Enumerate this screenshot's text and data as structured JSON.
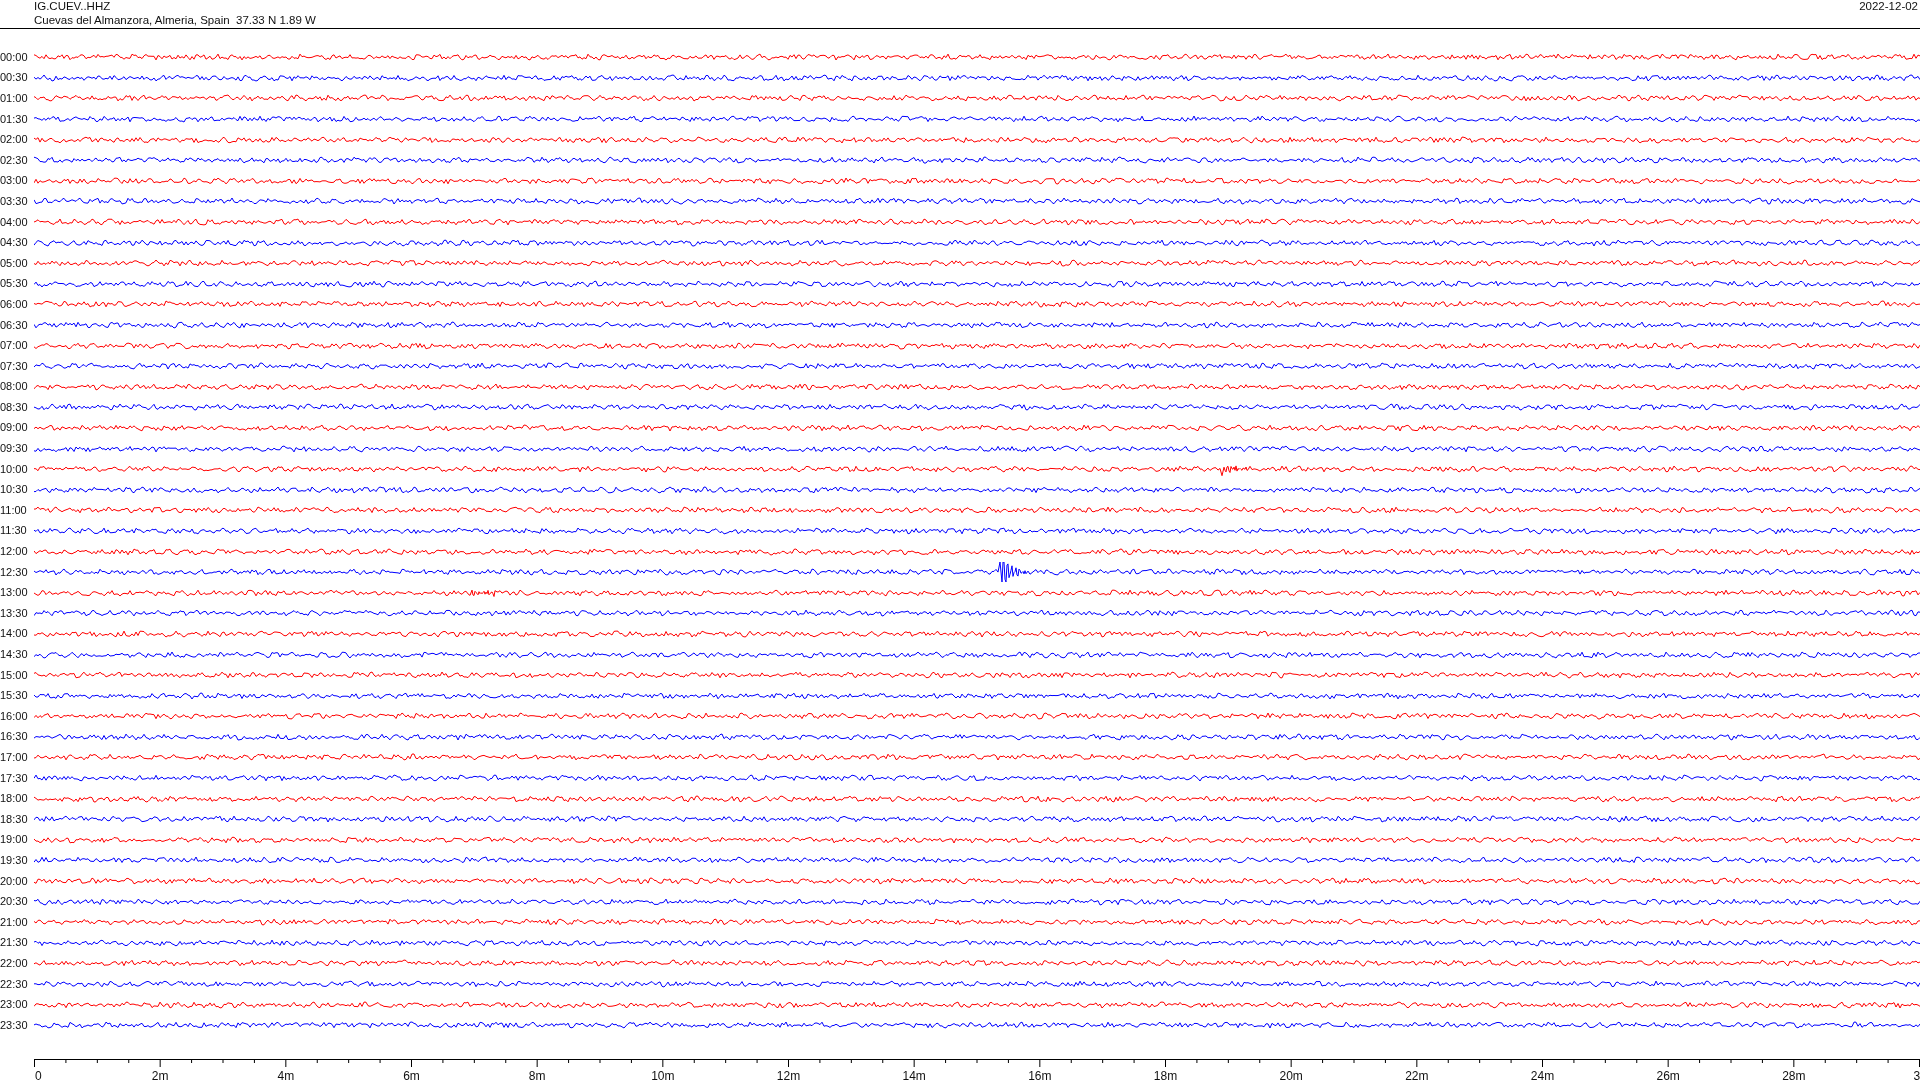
{
  "header": {
    "station": "IG.CUEV..HHZ",
    "location": "Cuevas del Almanzora, Almeria, Spain  37.33 N 1.89 W",
    "date": "2022-12-02"
  },
  "rows": [
    {
      "time": "00:00",
      "color": "#ff0000"
    },
    {
      "time": "00:30",
      "color": "#0000ff"
    },
    {
      "time": "01:00",
      "color": "#ff0000"
    },
    {
      "time": "01:30",
      "color": "#0000ff"
    },
    {
      "time": "02:00",
      "color": "#ff0000"
    },
    {
      "time": "02:30",
      "color": "#0000ff"
    },
    {
      "time": "03:00",
      "color": "#ff0000"
    },
    {
      "time": "03:30",
      "color": "#0000ff"
    },
    {
      "time": "04:00",
      "color": "#ff0000"
    },
    {
      "time": "04:30",
      "color": "#0000ff"
    },
    {
      "time": "05:00",
      "color": "#ff0000"
    },
    {
      "time": "05:30",
      "color": "#0000ff"
    },
    {
      "time": "06:00",
      "color": "#ff0000"
    },
    {
      "time": "06:30",
      "color": "#0000ff"
    },
    {
      "time": "07:00",
      "color": "#ff0000"
    },
    {
      "time": "07:30",
      "color": "#0000ff"
    },
    {
      "time": "08:00",
      "color": "#ff0000"
    },
    {
      "time": "08:30",
      "color": "#0000ff"
    },
    {
      "time": "09:00",
      "color": "#ff0000"
    },
    {
      "time": "09:30",
      "color": "#0000ff"
    },
    {
      "time": "10:00",
      "color": "#ff0000"
    },
    {
      "time": "10:30",
      "color": "#0000ff"
    },
    {
      "time": "11:00",
      "color": "#ff0000"
    },
    {
      "time": "11:30",
      "color": "#0000ff"
    },
    {
      "time": "12:00",
      "color": "#ff0000"
    },
    {
      "time": "12:30",
      "color": "#0000ff"
    },
    {
      "time": "13:00",
      "color": "#ff0000"
    },
    {
      "time": "13:30",
      "color": "#0000ff"
    },
    {
      "time": "14:00",
      "color": "#ff0000"
    },
    {
      "time": "14:30",
      "color": "#0000ff"
    },
    {
      "time": "15:00",
      "color": "#ff0000"
    },
    {
      "time": "15:30",
      "color": "#0000ff"
    },
    {
      "time": "16:00",
      "color": "#ff0000"
    },
    {
      "time": "16:30",
      "color": "#0000ff"
    },
    {
      "time": "17:00",
      "color": "#ff0000"
    },
    {
      "time": "17:30",
      "color": "#0000ff"
    },
    {
      "time": "18:00",
      "color": "#ff0000"
    },
    {
      "time": "18:30",
      "color": "#0000ff"
    },
    {
      "time": "19:00",
      "color": "#ff0000"
    },
    {
      "time": "19:30",
      "color": "#0000ff"
    },
    {
      "time": "20:00",
      "color": "#ff0000"
    },
    {
      "time": "20:30",
      "color": "#0000ff"
    },
    {
      "time": "21:00",
      "color": "#ff0000"
    },
    {
      "time": "21:30",
      "color": "#0000ff"
    },
    {
      "time": "22:00",
      "color": "#ff0000"
    },
    {
      "time": "22:30",
      "color": "#0000ff"
    },
    {
      "time": "23:00",
      "color": "#ff0000"
    },
    {
      "time": "23:30",
      "color": "#0000ff"
    }
  ],
  "x_axis": {
    "ticks": [
      "0",
      "2m",
      "4m",
      "6m",
      "8m",
      "10m",
      "12m",
      "14m",
      "16m",
      "18m",
      "20m",
      "22m",
      "24m",
      "26m",
      "28m",
      "3"
    ]
  }
}
